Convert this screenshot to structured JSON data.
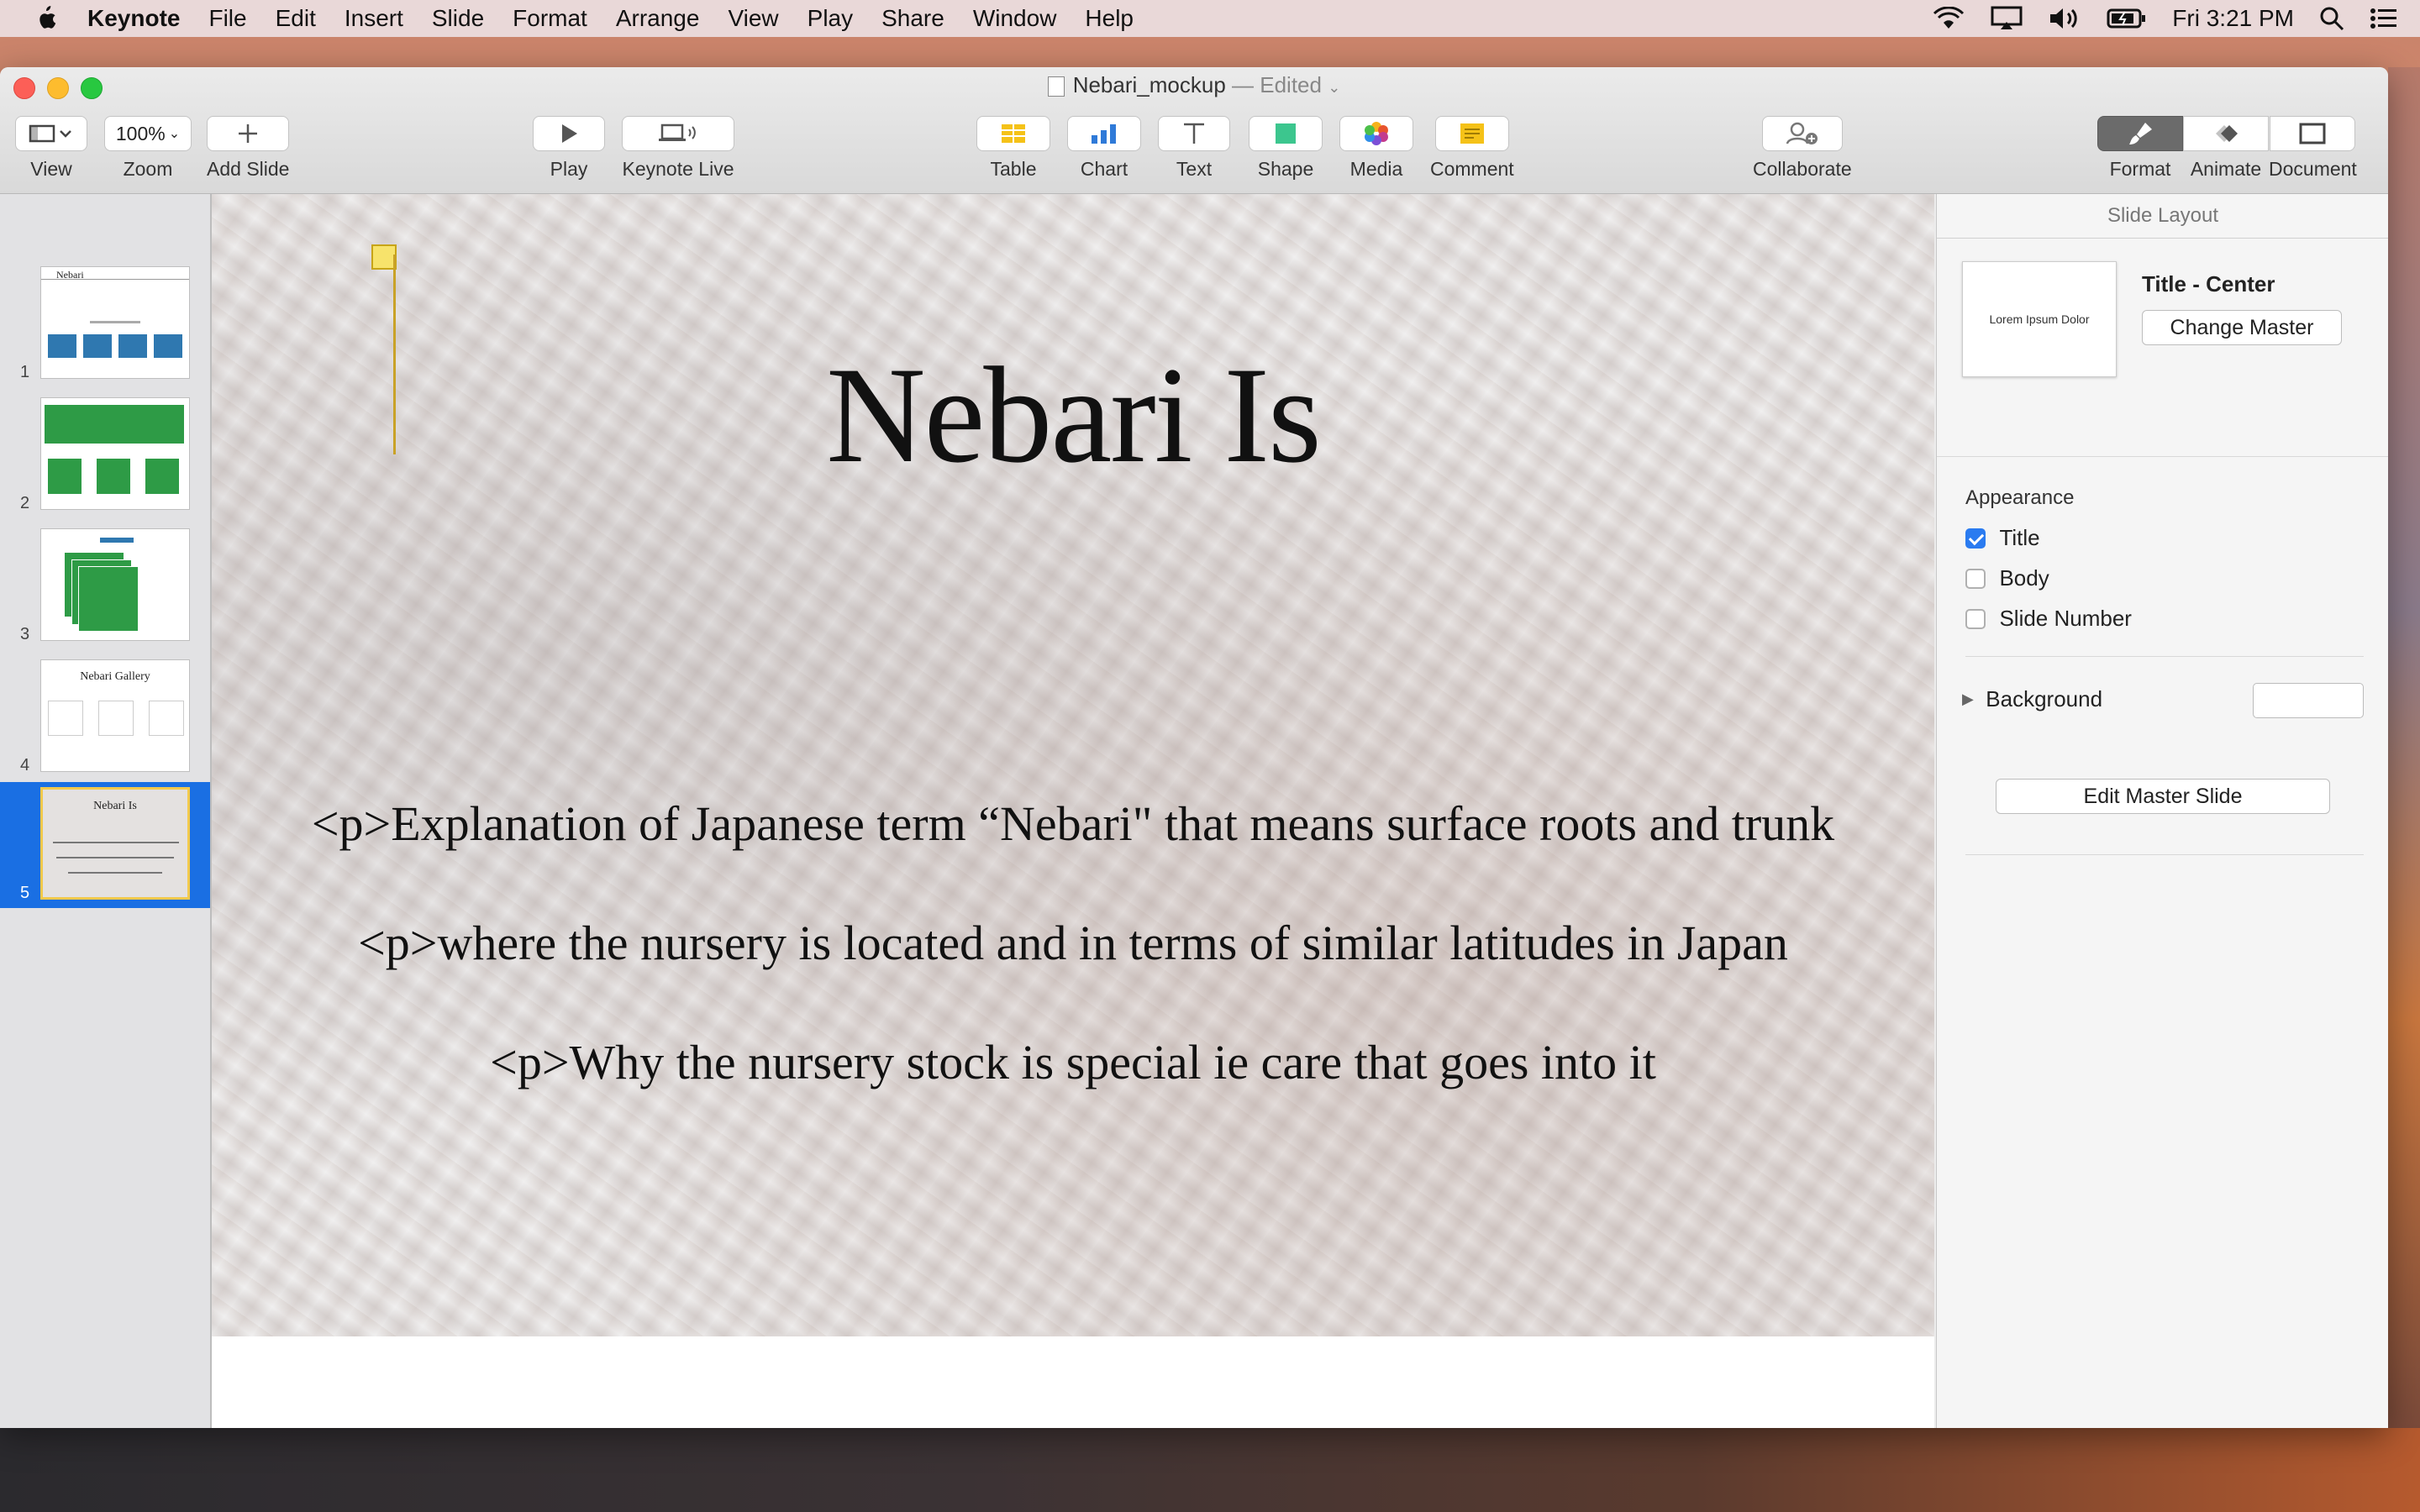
{
  "menubar": {
    "app_name": "Keynote",
    "items": [
      "File",
      "Edit",
      "Insert",
      "Slide",
      "Format",
      "Arrange",
      "View",
      "Play",
      "Share",
      "Window",
      "Help"
    ],
    "clock": "Fri 3:21 PM"
  },
  "window": {
    "doc_name": "Nebari_mockup",
    "doc_status": "— Edited"
  },
  "toolbar": {
    "view_label": "View",
    "zoom_value": "100%",
    "zoom_label": "Zoom",
    "add_slide_label": "Add Slide",
    "play_label": "Play",
    "keynote_live_label": "Keynote Live",
    "table_label": "Table",
    "chart_label": "Chart",
    "text_label": "Text",
    "shape_label": "Shape",
    "media_label": "Media",
    "comment_label": "Comment",
    "collaborate_label": "Collaborate",
    "format_label": "Format",
    "animate_label": "Animate",
    "document_label": "Document"
  },
  "slides": [
    {
      "number": "1",
      "title": "Nebari"
    },
    {
      "number": "2",
      "title": ""
    },
    {
      "number": "3",
      "title": ""
    },
    {
      "number": "4",
      "title": "Nebari Gallery"
    },
    {
      "number": "5",
      "title": "Nebari Is"
    }
  ],
  "current_slide": {
    "title": "Nebari Is",
    "lines": [
      "<p>Explanation of Japanese term “Nebari\" that means surface roots and trunk",
      "<p>where the nursery is located and in terms of similar latitudes in Japan",
      "<p>Why the nursery stock is special ie care that goes into it"
    ]
  },
  "inspector": {
    "header": "Slide Layout",
    "master_preview_text": "Lorem Ipsum Dolor",
    "master_name": "Title - Center",
    "change_master_label": "Change Master",
    "appearance_label": "Appearance",
    "options": [
      {
        "label": "Title",
        "checked": true
      },
      {
        "label": "Body",
        "checked": false
      },
      {
        "label": "Slide Number",
        "checked": false
      }
    ],
    "background_label": "Background",
    "edit_master_label": "Edit Master Slide"
  },
  "colors": {
    "selection_blue": "#1a6fe3",
    "slide_thumb_green": "#2e9b46",
    "slide_thumb_blue": "#2f78b0"
  }
}
